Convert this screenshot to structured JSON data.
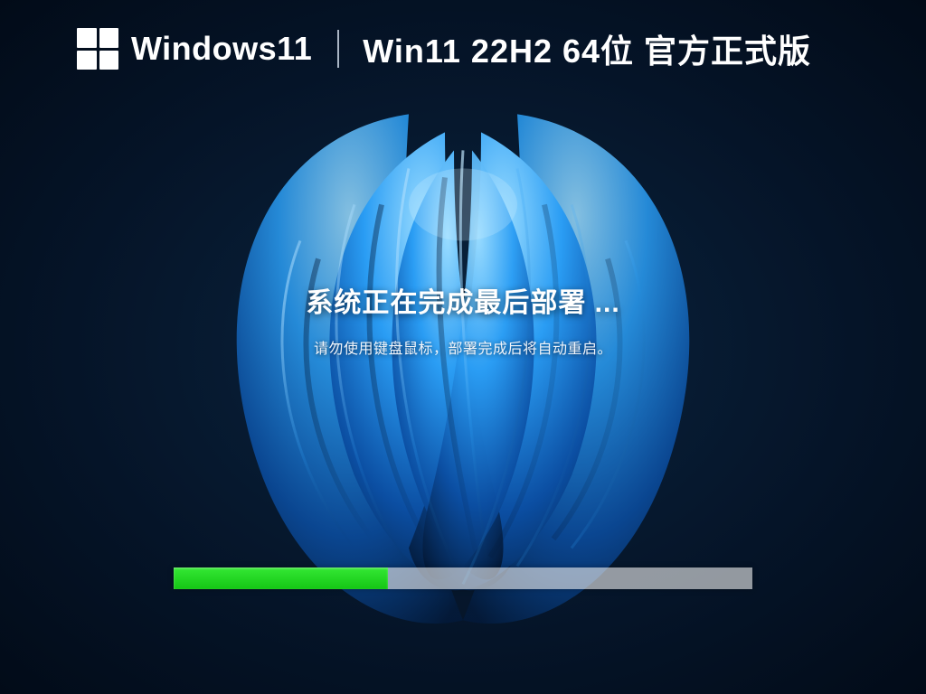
{
  "header": {
    "os_name": "Windows11",
    "version_title": "Win11 22H2 64位 官方正式版"
  },
  "status": {
    "main": "系统正在完成最后部署 ...",
    "sub": "请勿使用键盘鼠标，部署完成后将自动重启。"
  },
  "progress": {
    "percent": 37
  },
  "colors": {
    "bg_dark": "#051428",
    "accent_blue": "#0078d4",
    "progress_green": "#15c615"
  }
}
